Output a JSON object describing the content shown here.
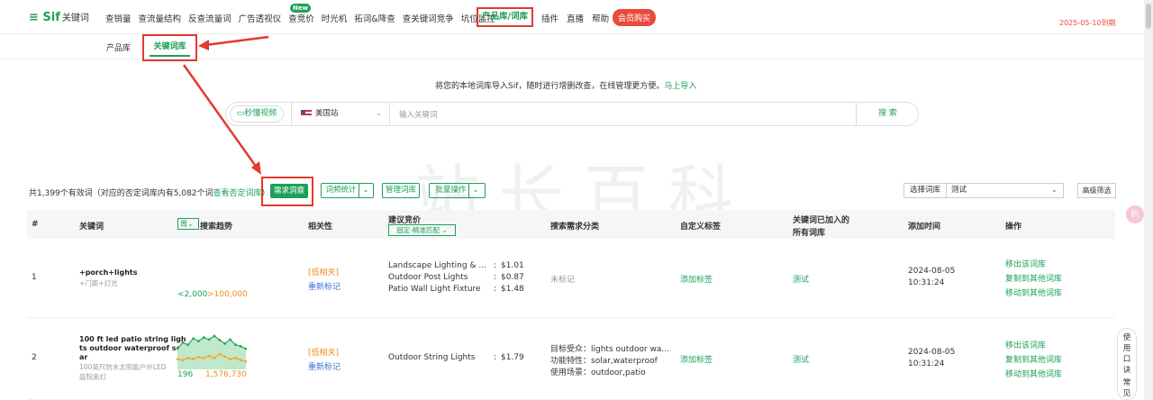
{
  "topnav": {
    "logo": "Sif",
    "logo_sub": "关键词",
    "items": [
      "查销量",
      "查流量结构",
      "反查流量词",
      "广告透视仪",
      "查竞价",
      "时光机",
      "拓词&降查",
      "查关键词竞争",
      "坑位监控"
    ],
    "new_badge": "New",
    "active": "产品库/词库",
    "items2": [
      "插件",
      "直播",
      "帮助"
    ],
    "vip": "会员购买",
    "expire": "2025-05-10到期"
  },
  "subnav": {
    "tabs": [
      "产品库",
      "关键词库"
    ]
  },
  "import": {
    "text": "将您的本地词库导入Sif，随时进行增删改查，在线管理更方便。",
    "link": "马上导入"
  },
  "search": {
    "video": "秒懂视频",
    "site": "美国站",
    "placeholder": "输入关键词",
    "button": "搜 索"
  },
  "toolbar": {
    "total_prefix": "共1,399个有效词（对应的否定词库内有5,082个词",
    "negative_link": "查看否定词库",
    "total_suffix": "）",
    "demand": "需求洞察",
    "stats": "词频统计",
    "manage": "管理词库",
    "batch": "批量操作",
    "choose_lib": "选择词库",
    "lib_value": "测试",
    "advanced": "高级筛选"
  },
  "table": {
    "headers": {
      "idx": "#",
      "keyword": "关键词",
      "trend": "搜索趋势",
      "week": "周",
      "relevance": "相关性",
      "bid": "建议竞价",
      "bid_filter": "固定-精准匹配",
      "demand": "搜索需求分类",
      "tag": "自定义标签",
      "libs1": "关键词已加入的",
      "libs2": "所有词库",
      "time": "添加时间",
      "ops": "操作"
    },
    "rows": [
      {
        "idx": "1",
        "kw": "+porch+lights",
        "kw_cn": "+门廊+灯光",
        "range_low": "<2,000",
        "range_high": ">100,000",
        "rel": "[低相关]",
        "remark": "重新标记",
        "bids": [
          {
            "name": "Landscape Lighting & ...",
            "price": "$1.01"
          },
          {
            "name": "Outdoor Post Lights",
            "price": "$0.87"
          },
          {
            "name": "Patio Wall Light Fixture",
            "price": "$1.48"
          }
        ],
        "demand": [
          "未标记"
        ],
        "tag": "添加标签",
        "lib": "测试",
        "date": "2024-08-05",
        "time": "10:31:24",
        "ops": [
          "移出该词库",
          "复制到其他词库",
          "移动到其他词库"
        ]
      },
      {
        "idx": "2",
        "kw_l1": "100 ft led patio string ligh",
        "kw_l2": "ts outdoor waterproof sol",
        "kw_l3": "ar",
        "kw_cn1": "100英尺防水太阳能户外LED",
        "kw_cn2": "庭院串灯",
        "min": "196",
        "max": "1,576,730",
        "rel": "[低相关]",
        "remark": "重新标记",
        "bids": [
          {
            "name": "Outdoor String Lights",
            "price": "$1.79"
          }
        ],
        "demand": [
          "目标受众：lights outdoor wa...",
          "功能特性：solar,waterproof",
          "使用场景：outdoor,patio"
        ],
        "tag": "添加标签",
        "lib": "测试",
        "date": "2024-08-05",
        "time": "10:31:24",
        "ops": [
          "移出该词库",
          "复制到其他词库",
          "移动到其他词库"
        ]
      }
    ]
  },
  "trend2": {
    "green": [
      40,
      52,
      48,
      60,
      55,
      62,
      58,
      65,
      57,
      50,
      58,
      48,
      45,
      40
    ],
    "orange": [
      20,
      18,
      22,
      20,
      24,
      22,
      26,
      22,
      30,
      25,
      20,
      22,
      18,
      15
    ]
  },
  "side": {
    "tip": "使用口诀",
    "tip2": "常见",
    "pink": "扒"
  },
  "watermark": "站长百科"
}
